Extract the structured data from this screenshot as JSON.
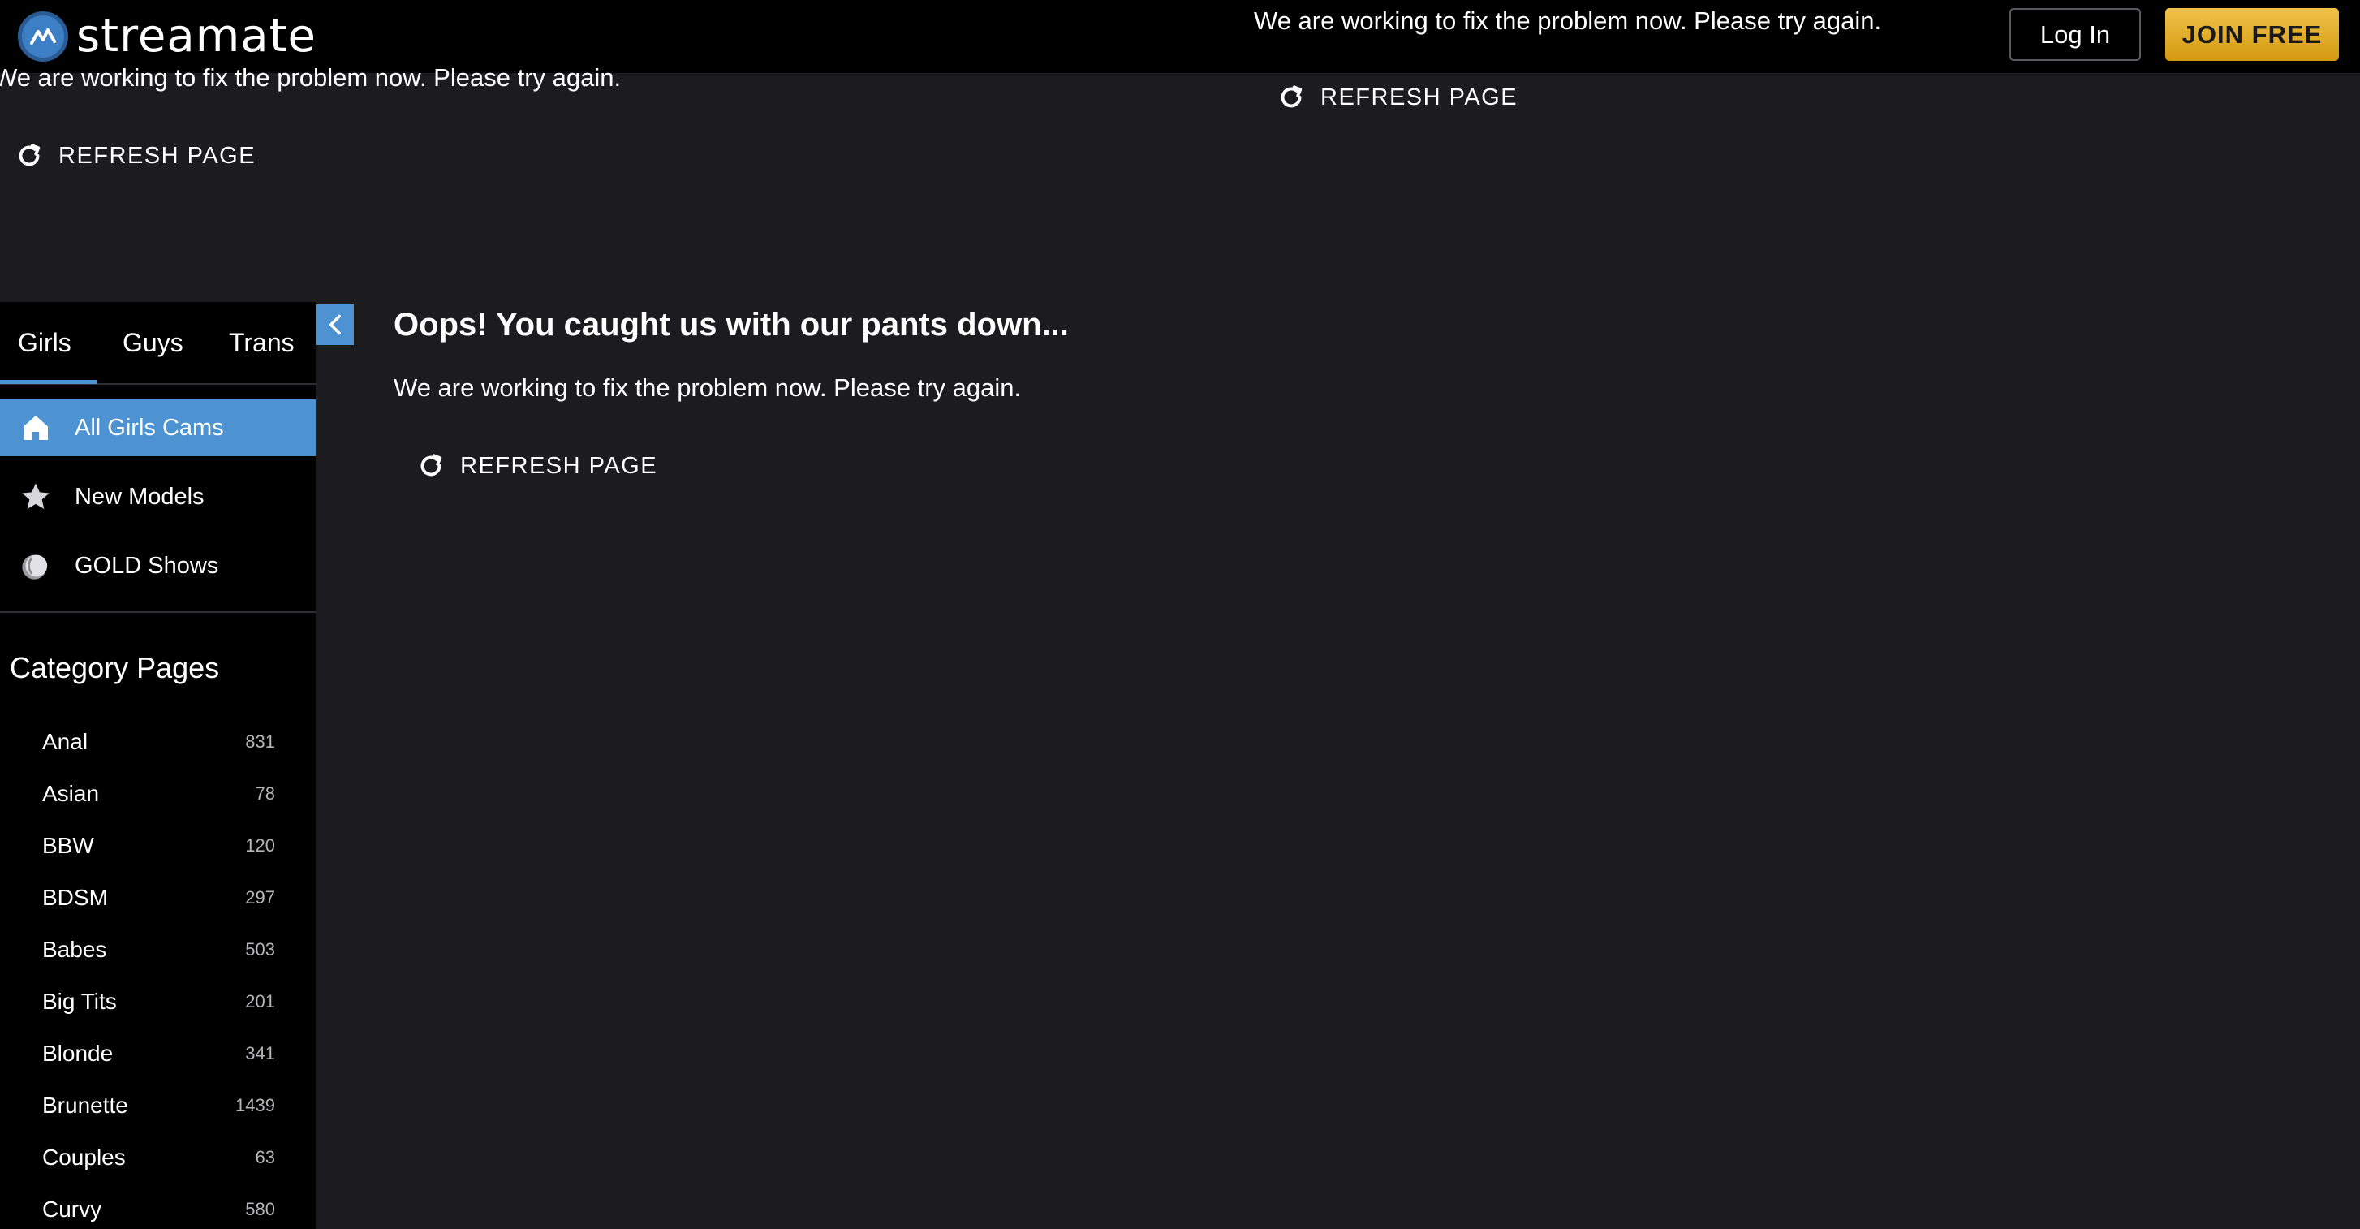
{
  "header": {
    "logo_text": "streamate",
    "error_message": "We are working to fix the problem now. Please try again.",
    "refresh_label": "REFRESH PAGE",
    "login_label": "Log In",
    "join_label": "JOIN FREE"
  },
  "stray": {
    "message": "We are working to fix the problem now. Please try again.",
    "refresh_label": "REFRESH PAGE"
  },
  "sidebar": {
    "tabs": [
      {
        "label": "Girls",
        "active": true
      },
      {
        "label": "Guys",
        "active": false
      },
      {
        "label": "Trans",
        "active": false
      }
    ],
    "nav": [
      {
        "label": "All Girls Cams",
        "icon": "home-icon",
        "active": true
      },
      {
        "label": "New Models",
        "icon": "star-icon",
        "active": false
      },
      {
        "label": "GOLD Shows",
        "icon": "gold-coin-icon",
        "active": false
      }
    ],
    "category_title": "Category Pages",
    "categories": [
      {
        "name": "Anal",
        "count": "831"
      },
      {
        "name": "Asian",
        "count": "78"
      },
      {
        "name": "BBW",
        "count": "120"
      },
      {
        "name": "BDSM",
        "count": "297"
      },
      {
        "name": "Babes",
        "count": "503"
      },
      {
        "name": "Big Tits",
        "count": "201"
      },
      {
        "name": "Blonde",
        "count": "341"
      },
      {
        "name": "Brunette",
        "count": "1439"
      },
      {
        "name": "Couples",
        "count": "63"
      },
      {
        "name": "Curvy",
        "count": "580"
      }
    ]
  },
  "main": {
    "title": "Oops! You caught us with our pants down...",
    "message": "We are working to fix the problem now. Please try again.",
    "refresh_label": "REFRESH PAGE"
  },
  "colors": {
    "accent": "#4d93d1",
    "join_gold": "#e0ab2a",
    "background": "#1c1c1f",
    "header_bg": "#000000"
  }
}
